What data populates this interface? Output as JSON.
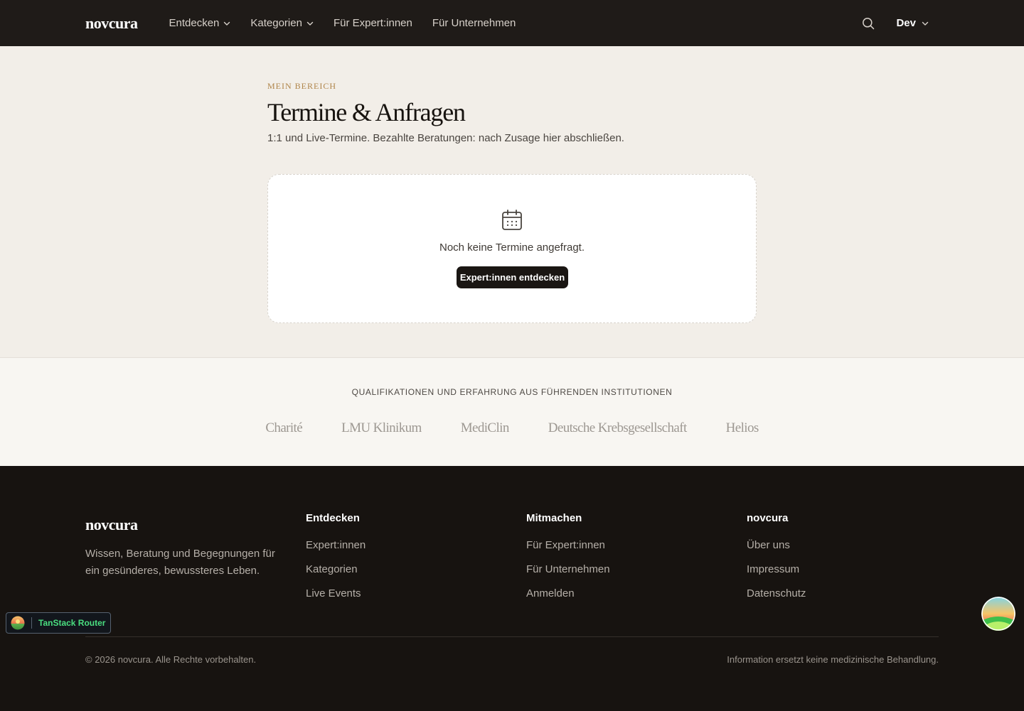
{
  "header": {
    "logo": "novcura",
    "nav": [
      {
        "label": "Entdecken",
        "has_dropdown": true
      },
      {
        "label": "Kategorien",
        "has_dropdown": true
      },
      {
        "label": "Für Expert:innen",
        "has_dropdown": false
      },
      {
        "label": "Für Unternehmen",
        "has_dropdown": false
      }
    ],
    "search_icon": "search-icon",
    "user_label": "Dev"
  },
  "main": {
    "eyebrow": "MEIN BEREICH",
    "title": "Termine & Anfragen",
    "subtitle": "1:1 und Live-Termine. Bezahlte Beratungen: nach Zusage hier abschließen.",
    "empty_state": {
      "icon": "calendar-icon",
      "text": "Noch keine Termine angefragt.",
      "button_label": "Expert:innen entdecken"
    }
  },
  "institutions": {
    "heading": "QUALIFIKATIONEN UND ERFAHRUNG AUS FÜHRENDEN INSTITUTIONEN",
    "logos": [
      "Charité",
      "LMU Klinikum",
      "MediClin",
      "Deutsche Krebsgesellschaft",
      "Helios"
    ]
  },
  "footer": {
    "logo": "novcura",
    "tagline": "Wissen, Beratung und Begegnungen für ein gesünderes, bewussteres Leben.",
    "columns": [
      {
        "title": "Entdecken",
        "links": [
          "Expert:innen",
          "Kategorien",
          "Live Events"
        ]
      },
      {
        "title": "Mitmachen",
        "links": [
          "Für Expert:innen",
          "Für Unternehmen",
          "Anmelden"
        ]
      },
      {
        "title": "novcura",
        "links": [
          "Über uns",
          "Impressum",
          "Datenschutz"
        ]
      }
    ],
    "copyright": "© 2026 novcura. Alle Rechte vorbehalten.",
    "disclaimer": "Information ersetzt keine medizinische Behandlung."
  },
  "devtools": {
    "router_label": "TanStack Router"
  },
  "colors": {
    "header_bg": "#1f1b18",
    "page_bg": "#f2eee8",
    "accent_gold": "#b0854a",
    "footer_bg": "#171310",
    "router_green": "#4ade80"
  }
}
